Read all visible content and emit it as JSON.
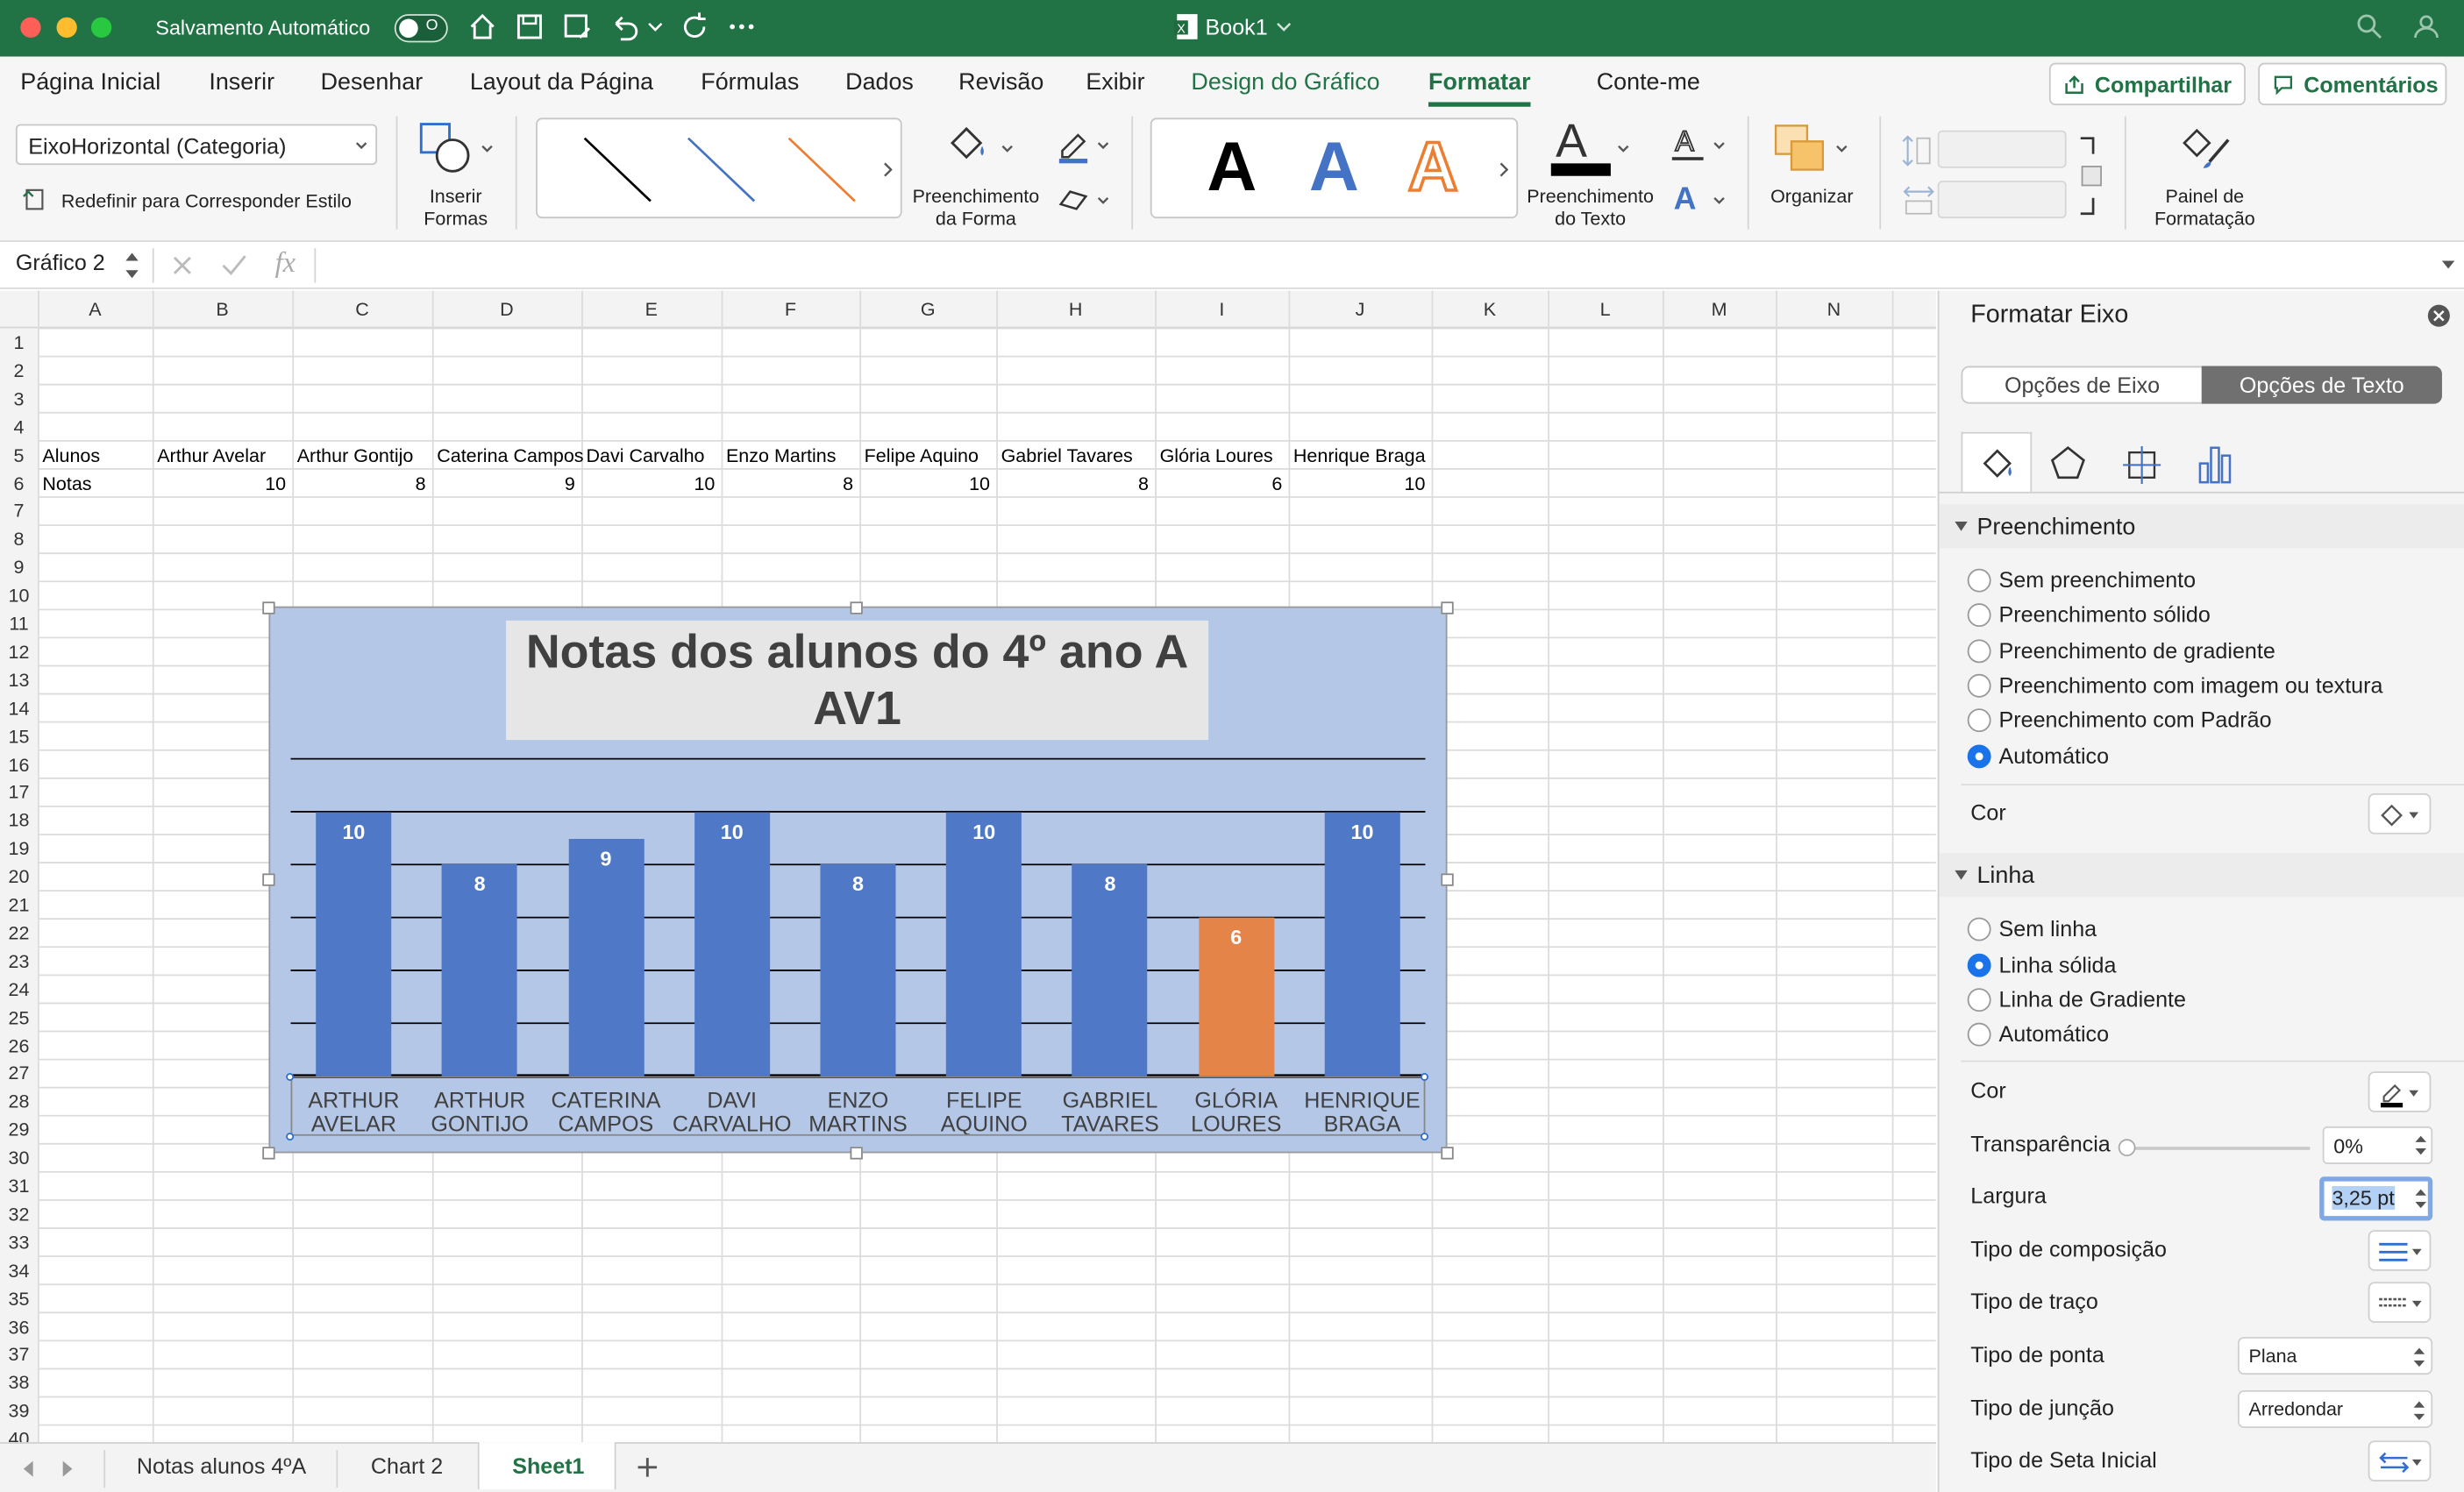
{
  "titlebar": {
    "autosave": "Salvamento Automático",
    "toggle_state": "O",
    "doc_title": "Book1"
  },
  "tabs": [
    "Página Inicial",
    "Inserir",
    "Desenhar",
    "Layout da Página",
    "Fórmulas",
    "Dados",
    "Revisão",
    "Exibir",
    "Design do Gráfico",
    "Formatar",
    "Conte-me"
  ],
  "share": {
    "share_label": "Compartilhar",
    "comments_label": "Comentários"
  },
  "ribbon": {
    "element_selector": "EixoHorizontal (Categoria)",
    "reset_style": "Redefinir para Corresponder Estilo",
    "insert_shapes": "Inserir\nFormas",
    "shape_fill": "Preenchimento\nda Forma",
    "wordart_letter": "A",
    "text_fill": "Preenchimento\ndo Texto",
    "arrange": "Organizar",
    "format_pane": "Painel de\nFormatação"
  },
  "formula_bar": {
    "name_box": "Gráfico 2"
  },
  "columns": [
    "A",
    "B",
    "C",
    "D",
    "E",
    "F",
    "G",
    "H",
    "I",
    "J",
    "K",
    "L",
    "M",
    "N"
  ],
  "rows": [
    "1",
    "2",
    "3",
    "4",
    "5",
    "6",
    "7",
    "8",
    "9",
    "10",
    "11",
    "12",
    "13",
    "14",
    "15",
    "16",
    "17",
    "18",
    "19",
    "20",
    "21",
    "22",
    "23",
    "24",
    "25",
    "26",
    "27",
    "28",
    "29",
    "30",
    "31",
    "32",
    "33",
    "34",
    "35",
    "36",
    "37",
    "38",
    "39",
    "40"
  ],
  "sheet": {
    "row5": [
      "Alunos",
      "Arthur Avelar",
      "Arthur Gontijo",
      "Caterina Campos",
      "Davi Carvalho",
      "Enzo Martins",
      "Felipe Aquino",
      "Gabriel Tavares",
      "Glória Loures",
      "Henrique Braga"
    ],
    "row6": [
      "Notas",
      "10",
      "8",
      "9",
      "10",
      "8",
      "10",
      "8",
      "6",
      "10"
    ]
  },
  "chart_data": {
    "type": "bar",
    "title": "Notas dos alunos do 4º ano A\nAV1",
    "categories": [
      "ARTHUR\nAVELAR",
      "ARTHUR\nGONTIJO",
      "CATERINA\nCAMPOS",
      "DAVI\nCARVALHO",
      "ENZO\nMARTINS",
      "FELIPE\nAQUINO",
      "GABRIEL\nTAVARES",
      "GLÓRIA\nLOURES",
      "HENRIQUE\nBRAGA"
    ],
    "values": [
      10,
      8,
      9,
      10,
      8,
      10,
      8,
      6,
      10
    ],
    "bar_colors": [
      "#4f79c6",
      "#4f79c6",
      "#4f79c6",
      "#4f79c6",
      "#4f79c6",
      "#4f79c6",
      "#4f79c6",
      "#e58449",
      "#4f79c6"
    ],
    "ylim": [
      0,
      12
    ],
    "grid": true,
    "data_labels": [
      "10",
      "8",
      "9",
      "10",
      "8",
      "10",
      "8",
      "6",
      "10"
    ]
  },
  "panel": {
    "title": "Formatar Eixo",
    "tab_axis": "Opções de Eixo",
    "tab_text": "Opções de Texto",
    "fill_section": "Preenchimento",
    "fill_options": [
      "Sem preenchimento",
      "Preenchimento sólido",
      "Preenchimento de gradiente",
      "Preenchimento com imagem ou textura",
      "Preenchimento com Padrão",
      "Automático"
    ],
    "color_label": "Cor",
    "line_section": "Linha",
    "line_options": [
      "Sem linha",
      "Linha sólida",
      "Linha de Gradiente",
      "Automático"
    ],
    "line_color_label": "Cor",
    "transparency_label": "Transparência",
    "transparency_value": "0%",
    "width_label": "Largura",
    "width_value": "3,25 pt",
    "compound_label": "Tipo de composição",
    "dash_label": "Tipo de traço",
    "cap_label": "Tipo de ponta",
    "cap_value": "Plana",
    "join_label": "Tipo de junção",
    "join_value": "Arredondar",
    "arrow_label": "Tipo de Seta Inicial"
  },
  "sheet_tabs": [
    "Notas alunos 4ºA",
    "Chart 2",
    "Sheet1"
  ],
  "colors": {
    "excel_green": "#217346",
    "accent_blue": "#1a73e8",
    "bar_blue": "#4f79c6",
    "bar_orange": "#e58449",
    "chart_bg": "#b4c7e7"
  }
}
